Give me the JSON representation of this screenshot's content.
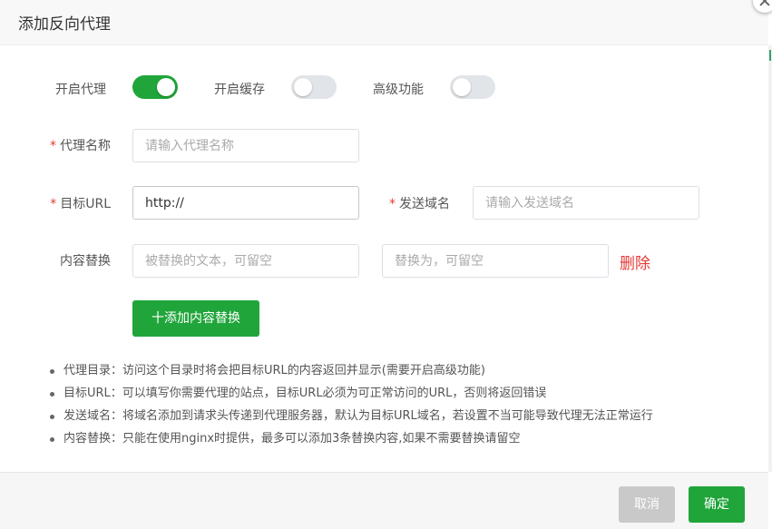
{
  "dialog": {
    "title": "添加反向代理"
  },
  "switches": [
    {
      "label": "开启代理",
      "on": true
    },
    {
      "label": "开启缓存",
      "on": false
    },
    {
      "label": "高级功能",
      "on": false
    }
  ],
  "form": {
    "required_mark": "*",
    "proxy_name": {
      "label": "代理名称",
      "value": "",
      "placeholder": "请输入代理名称"
    },
    "target_url": {
      "label": "目标URL",
      "value": "http://"
    },
    "send_domain": {
      "label": "发送域名",
      "value": "",
      "placeholder": "请输入发送域名"
    },
    "content_replace": {
      "label": "内容替换",
      "from_placeholder": "被替换的文本，可留空",
      "to_placeholder": "替换为，可留空",
      "delete_label": "删除"
    },
    "add_replace_label": "十添加内容替换"
  },
  "tips": [
    "代理目录：访问这个目录时将会把目标URL的内容返回并显示(需要开启高级功能)",
    "目标URL：可以填写你需要代理的站点，目标URL必须为可正常访问的URL，否则将返回错误",
    "发送域名：将域名添加到请求头传递到代理服务器，默认为目标URL域名，若设置不当可能导致代理无法正常运行",
    "内容替换：只能在使用nginx时提供，最多可以添加3条替换内容,如果不需要替换请留空"
  ],
  "footer": {
    "cancel_label": "取消",
    "confirm_label": "确定"
  },
  "colors": {
    "accent": "#20a53a",
    "danger": "#e53935",
    "disabled": "#c9c9c9"
  }
}
